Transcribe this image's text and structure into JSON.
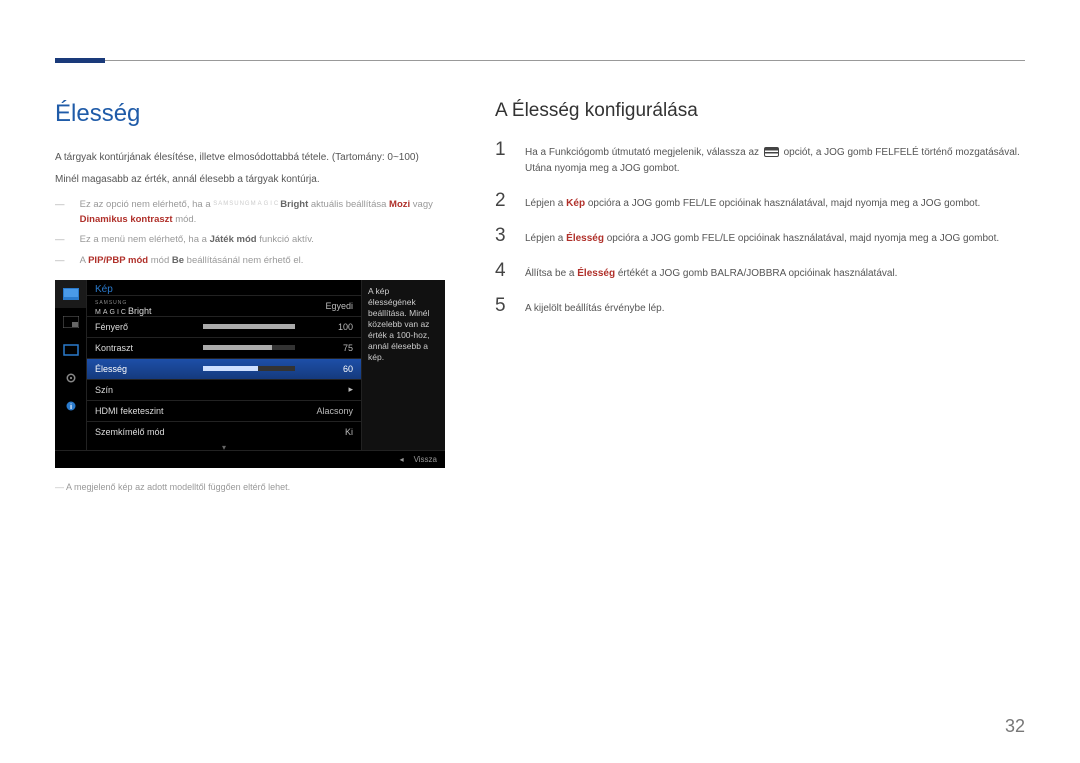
{
  "page_number": "32",
  "left": {
    "heading": "Élesség",
    "intro1": "A tárgyak kontúrjának élesítése, illetve elmosódottabbá tétele. (Tartomány: 0~100)",
    "intro2": "Minél magasabb az érték, annál élesebb a tárgyak kontúrja.",
    "note1_pre": "Ez az opció nem elérhető, ha a ",
    "note1_brand_small": "SAMSUNG",
    "note1_brand_magic": "MAGIC",
    "note1_bright": "Bright",
    "note1_mid": " aktuális beállítása ",
    "note1_mozi": "Mozi",
    "note1_post": " vagy ",
    "note1_dk": "Dinamikus kontraszt",
    "note1_end": " mód.",
    "note2_pre": "Ez a menü nem elérhető, ha a ",
    "note2_bold": "Játék mód",
    "note2_post": " funkció aktív.",
    "note3_pre": "A ",
    "note3_red": "PIP/PBP mód",
    "note3_mid": " mód ",
    "note3_bold": "Be",
    "note3_post": " beállításánál nem érhető el.",
    "caption": "A megjelenő kép az adott modelltől függően eltérő lehet."
  },
  "osd": {
    "title": "Kép",
    "tooltip": "A kép élességének beállítása. Minél közelebb van az érték a 100-hoz, annál élesebb a kép.",
    "footer_back": "Vissza",
    "scroll_indicator": "▾",
    "rows": [
      {
        "label_prefix_small": "SAMSUNG",
        "label_prefix_magic": "MAGIC",
        "label_suffix": "Bright",
        "value": "Egyedi",
        "bar": null
      },
      {
        "label": "Fényerő",
        "value": "100",
        "bar": 100
      },
      {
        "label": "Kontraszt",
        "value": "75",
        "bar": 75
      },
      {
        "label": "Élesség",
        "value": "60",
        "bar": 60,
        "selected": true
      },
      {
        "label": "Szín",
        "value": "",
        "arrow": true
      },
      {
        "label": "HDMI feketeszint",
        "value": "Alacsony"
      },
      {
        "label": "Szemkímélő mód",
        "value": "Ki"
      }
    ]
  },
  "right": {
    "heading": "A Élesség konfigurálása",
    "steps": [
      {
        "n": "1",
        "pre": "Ha a Funkciógomb útmutató megjelenik, válassza az ",
        "icon": true,
        "post": " opciót, a JOG gomb FELFELÉ történő mozgatásával. Utána nyomja meg a JOG gombot."
      },
      {
        "n": "2",
        "pre": "Lépjen a ",
        "bold": "Kép",
        "post": " opcióra a JOG gomb FEL/LE opcióinak használatával, majd nyomja meg a JOG gombot."
      },
      {
        "n": "3",
        "pre": "Lépjen a ",
        "bold": "Élesség",
        "post": " opcióra a JOG gomb FEL/LE opcióinak használatával, majd nyomja meg a JOG gombot."
      },
      {
        "n": "4",
        "pre": "Állítsa be a ",
        "bold": "Élesség",
        "post": " értékét a JOG gomb BALRA/JOBBRA opcióinak használatával."
      },
      {
        "n": "5",
        "pre": "A kijelölt beállítás érvénybe lép."
      }
    ]
  }
}
